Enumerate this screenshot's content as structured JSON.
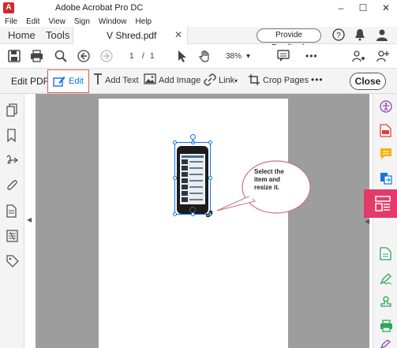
{
  "window": {
    "title": "Adobe Acrobat Pro DC",
    "logo": "A",
    "minimize": "–",
    "maximize": "☐",
    "close": "✕"
  },
  "menu": [
    "File",
    "Edit",
    "View",
    "Sign",
    "Window",
    "Help"
  ],
  "tabs": {
    "home": "Home",
    "tools": "Tools",
    "document": "V Shred.pdf",
    "document_close": "✕",
    "feedback": "Provide Feedback"
  },
  "toolbar": {
    "page_current": "1",
    "page_sep": "/",
    "page_total": "1",
    "zoom": "38%",
    "zoom_caret": "▾",
    "more": "•••"
  },
  "edit_bar": {
    "title": "Edit PDF",
    "edit": "Edit",
    "add_text": "Add Text",
    "add_image": "Add Image",
    "link": "Link",
    "link_caret": "▾",
    "crop_pages": "Crop Pages",
    "more": "•••",
    "close": "Close"
  },
  "callout": {
    "text": "Select the item and resize it."
  },
  "icons": {
    "left_rail": [
      "pages-icon",
      "bookmark-icon",
      "signature-icon",
      "attachment-icon",
      "document-icon",
      "layers-icon",
      "tag-icon"
    ],
    "right_rail": [
      "accessibility-icon",
      "create-pdf-icon",
      "comment-icon",
      "export-pdf-icon",
      "edit-pdf-icon",
      "organize-pages-icon",
      "fill-sign-icon",
      "stamp-icon",
      "print-icon",
      "sign-icon"
    ]
  },
  "colors": {
    "accent_blue": "#1473e6",
    "active_rail": "#e33a6a",
    "edit_highlight_border": "#d85a5a",
    "canvas_gray": "#9d9d9d"
  }
}
